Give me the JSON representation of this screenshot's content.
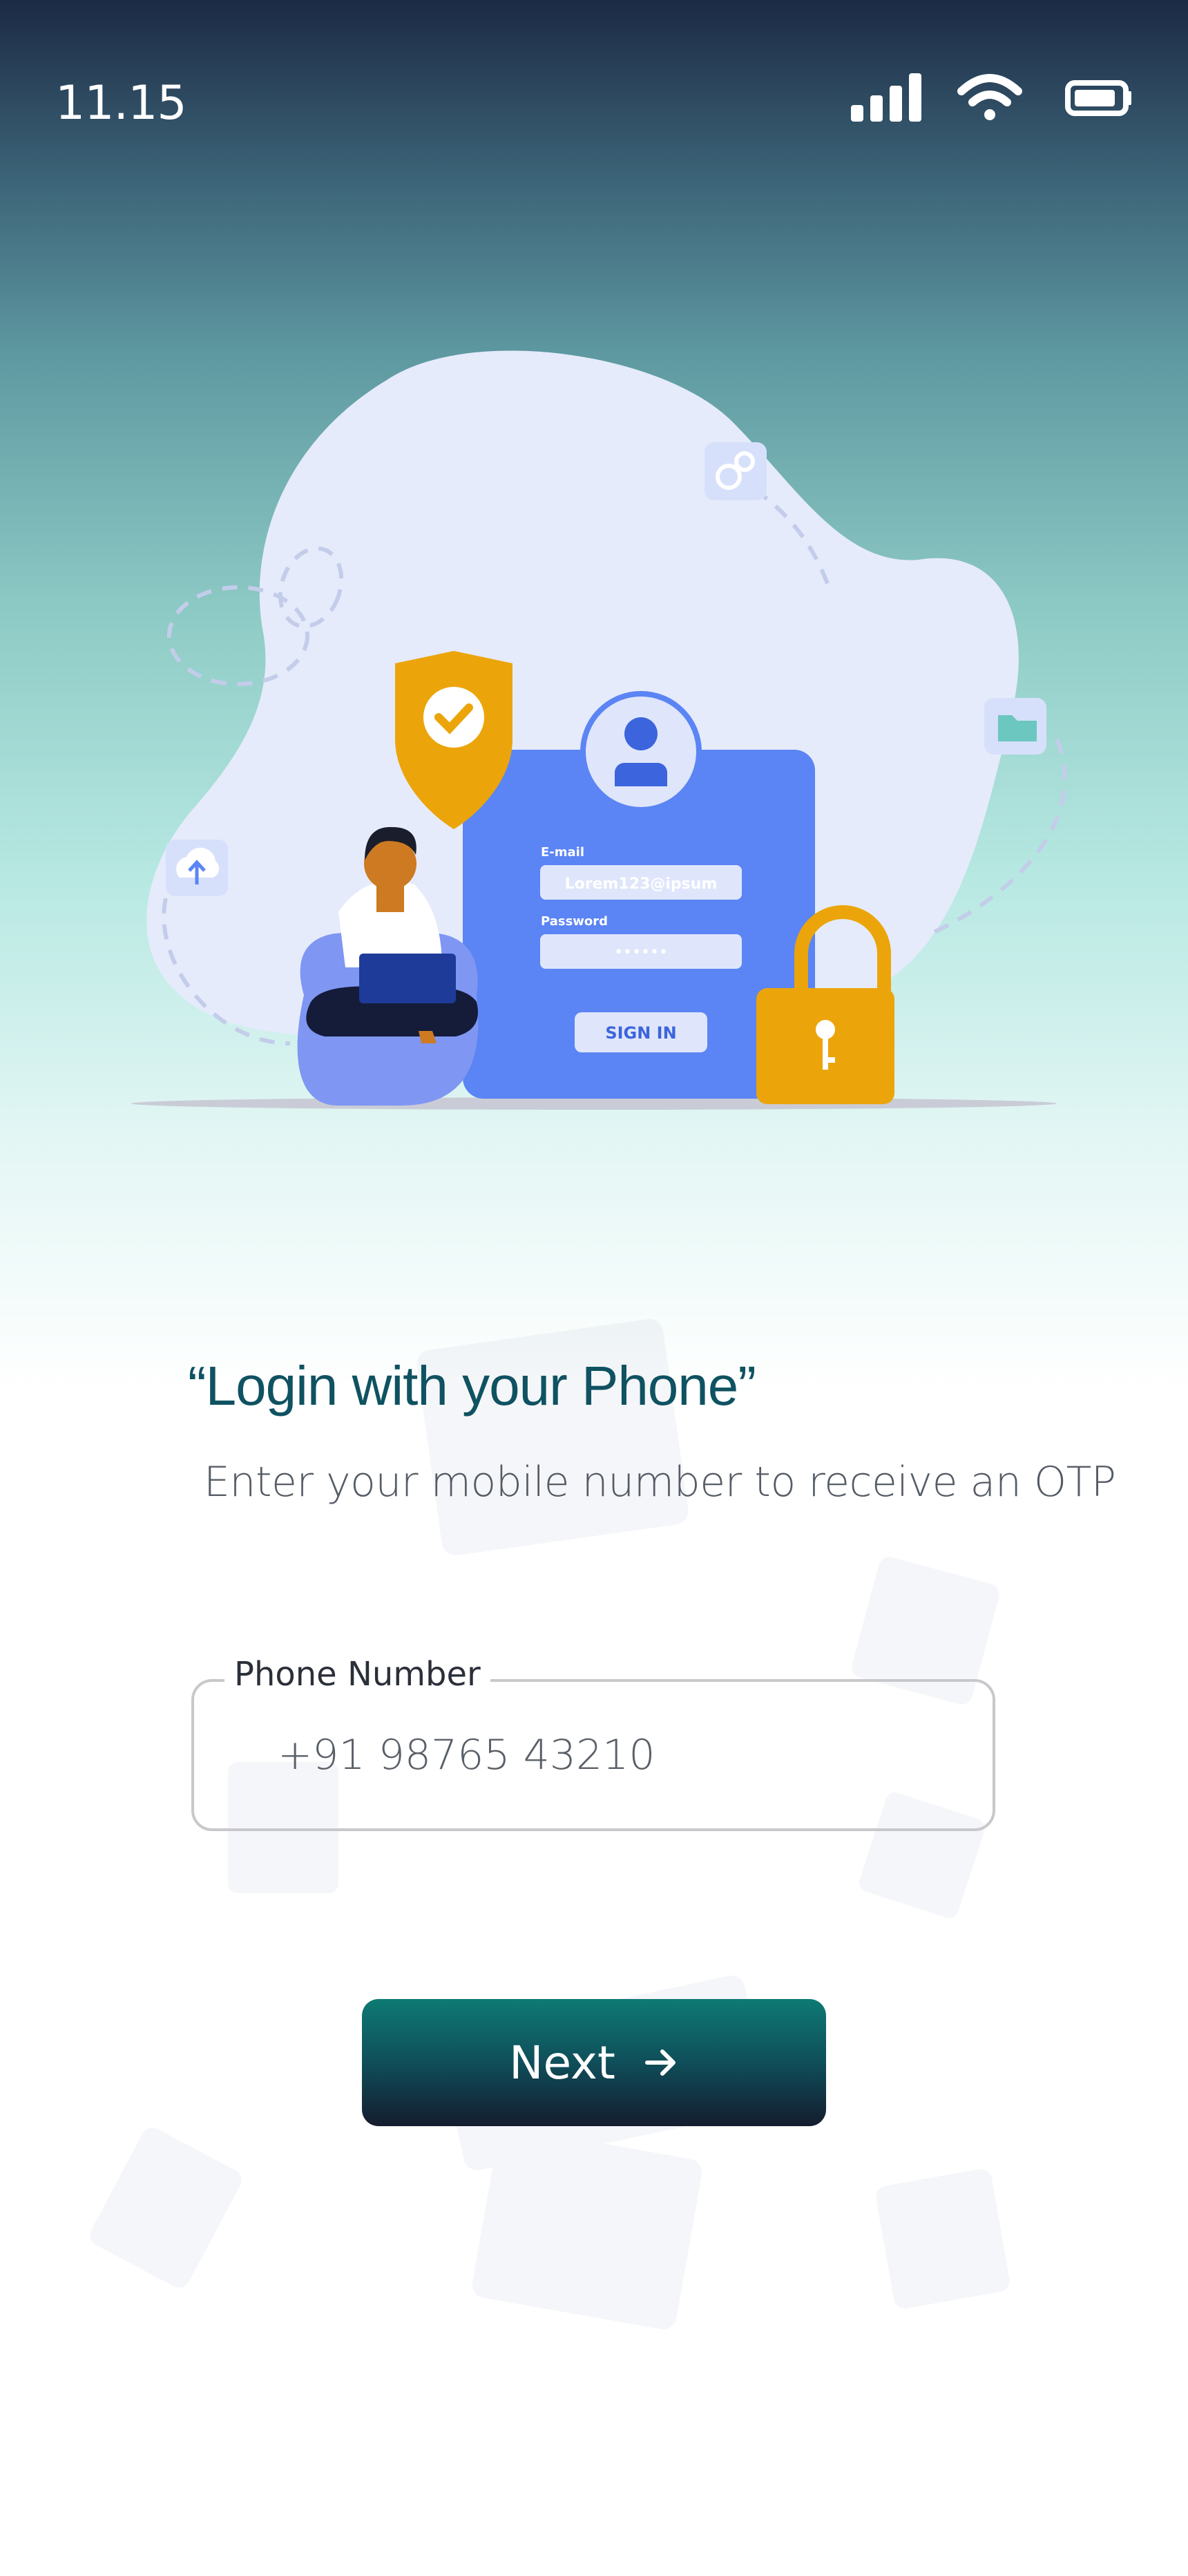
{
  "status_bar": {
    "time": "11.15",
    "icons": [
      "signal-icon",
      "wifi-icon",
      "battery-icon"
    ]
  },
  "illustration": {
    "email_label": "E-mail",
    "email_value": "Lorem123@ipsum",
    "password_label": "Password",
    "password_value": "••••••",
    "signin_label": "SIGN IN"
  },
  "login": {
    "title": "“Login with your Phone”",
    "subtitle": "Enter your mobile number to receive an OTP",
    "phone_label": "Phone Number",
    "phone_value": "+91 98765 43210",
    "next_label": "Next",
    "next_icon": "arrow-right-icon"
  },
  "colors": {
    "title": "#0f5261",
    "button_top": "#0e7a74",
    "button_bottom": "#141c2e",
    "illustration_blue": "#5b84f4",
    "illustration_gold": "#eba50b"
  }
}
